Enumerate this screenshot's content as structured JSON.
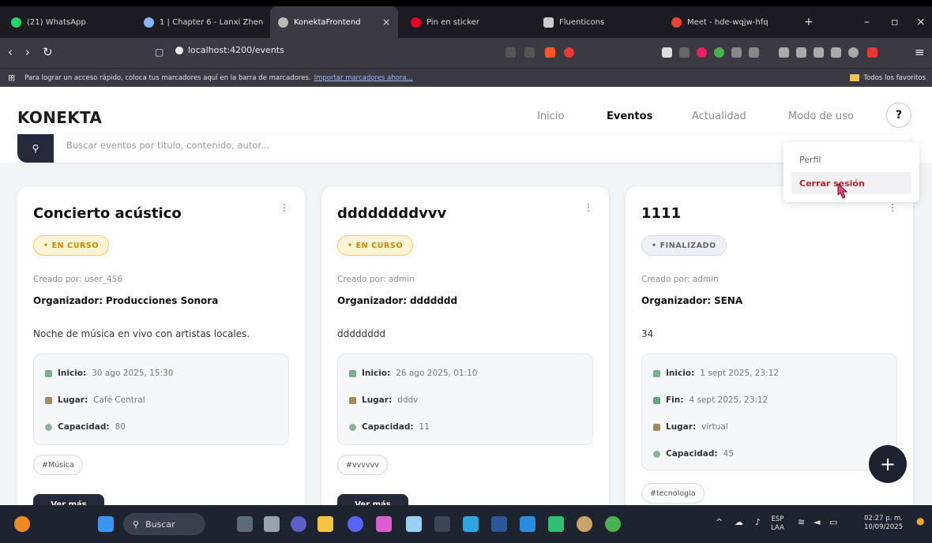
{
  "browser": {
    "tabs": [
      {
        "label": "(21) WhatsApp",
        "icon": "whatsapp-icon",
        "color": "#25d366"
      },
      {
        "label": "1 | Chapter 6 - Lanxi Zhen",
        "icon": "audio-icon",
        "color": "#8ab4f8"
      },
      {
        "label": "KonektaFrontend",
        "icon": "globe-icon",
        "color": "#bbbbbb",
        "active": true
      },
      {
        "label": "Pin en sticker",
        "icon": "pinterest-icon",
        "color": "#e60023"
      },
      {
        "label": "Fluenticons",
        "icon": "fluenticons-icon",
        "color": "#cccccc"
      },
      {
        "label": "Meet - hde-wqjw-hfq",
        "icon": "meet-icon",
        "color": "#ea4335"
      }
    ],
    "new_tab": "+",
    "url": "localhost:4200/events",
    "bookmarks_hint": "Para lograr un acceso rápido, coloca tus marcadores aquí en la barra de marcadores.",
    "bookmarks_link": "Importar marcadores ahora...",
    "all_favorites": "Todos los favoritos"
  },
  "app": {
    "logo": "KONEKTA",
    "nav": {
      "inicio": "Inicio",
      "eventos": "Eventos",
      "actualidad": "Actualidad",
      "modo_uso": "Modo de uso"
    },
    "help": "?",
    "search_placeholder": "Buscar eventos por título, contenido, autor...",
    "dropdown": {
      "perfil": "Perfil",
      "logout": "Cerrar sesión"
    },
    "fab": "+"
  },
  "cards": [
    {
      "title": "Concierto acústico",
      "status": "• EN CURSO",
      "creator": "Creado por: user_456",
      "org_label": "Organizador:",
      "org": "Producciones Sonora",
      "desc": "Noche de música en vivo con artistas locales.",
      "info": [
        {
          "label": "Inicio:",
          "value": "30 ago 2025, 15:30"
        },
        {
          "label": "Lugar:",
          "value": "Café Central"
        },
        {
          "label": "Capacidad:",
          "value": "80"
        }
      ],
      "tag": "#Música",
      "button": "Ver más"
    },
    {
      "title": "ddddddddvvv",
      "status": "• EN CURSO",
      "creator": "Creado por: admin",
      "org_label": "Organizador:",
      "org": "ddddddd",
      "desc": "dddddddd",
      "info": [
        {
          "label": "Inicio:",
          "value": "26 ago 2025, 01:10"
        },
        {
          "label": "Lugar:",
          "value": "dddv"
        },
        {
          "label": "Capacidad:",
          "value": "11"
        }
      ],
      "tag": "#vvvvvv",
      "button": "Ver más"
    },
    {
      "title": "1111",
      "status": "• FINALIZADO",
      "creator": "Creado por: admin",
      "org_label": "Organizador:",
      "org": "SENA",
      "desc": "34",
      "info": [
        {
          "label": "Inicio:",
          "value": "1 sept 2025, 23:12"
        },
        {
          "label": "Fin:",
          "value": "4 sept 2025, 23:12"
        },
        {
          "label": "Lugar:",
          "value": "virtual"
        },
        {
          "label": "Capacidad:",
          "value": "45"
        }
      ],
      "tag": "#tecnologia"
    }
  ],
  "taskbar": {
    "search": "Buscar",
    "lang": "ESP",
    "lang2": "LAA",
    "time": "02:27 p. m.",
    "date": "10/09/2025"
  }
}
